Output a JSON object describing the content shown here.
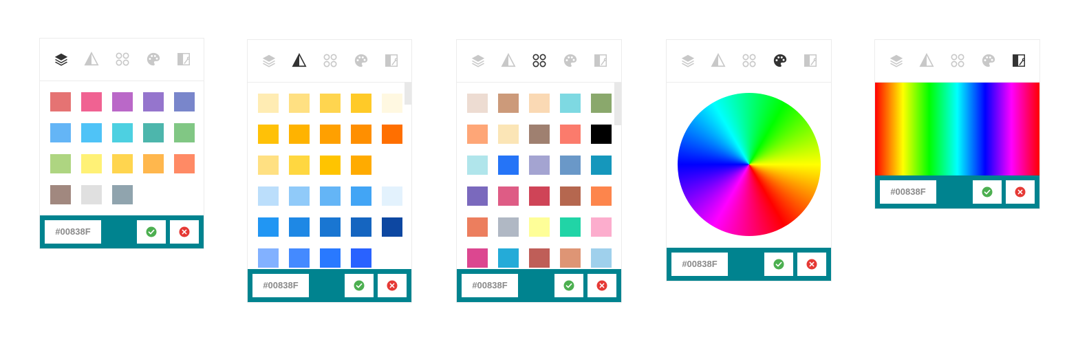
{
  "tab_icons": [
    "layers-icon",
    "shades-icon",
    "swatches-icon",
    "palette-icon",
    "spectrum-icon"
  ],
  "panels": [
    {
      "active_tab": "layers",
      "hex_value": "#00838F",
      "colors": [
        "#e57373",
        "#f06292",
        "#ba68c8",
        "#9575cd",
        "#7986cb",
        "#64b5f6",
        "#4fc3f7",
        "#4dd0e1",
        "#4db6ac",
        "#81c784",
        "#aed581",
        "#fff176",
        "#ffd54f",
        "#ffb74d",
        "#ff8a65",
        "#a1887f",
        "#e0e0e0",
        "#90a4ae"
      ]
    },
    {
      "active_tab": "shades",
      "hex_value": "#00838F",
      "colors": [
        "#ffecb3",
        "#ffe082",
        "#ffd54f",
        "#ffca28",
        "#fff8e1",
        "#ffc107",
        "#ffb300",
        "#ffa000",
        "#ff8f00",
        "#ff6f00",
        "#ffe082",
        "#ffd740",
        "#ffc400",
        "#ffab00",
        null,
        "#bbdefb",
        "#90caf9",
        "#64b5f6",
        "#42a5f5",
        "#e3f2fd",
        "#2196f3",
        "#1e88e5",
        "#1976d2",
        "#1565c0",
        "#0d47a1",
        "#82b1ff",
        "#448aff",
        "#2979ff",
        "#2962ff",
        null
      ]
    },
    {
      "active_tab": "swatches",
      "hex_value": "#00838F",
      "colors": [
        "#eddcd2",
        "#cc9a7a",
        "#fad9b4",
        "#7ed9e2",
        "#8aa86c",
        "#fea677",
        "#fbe5b6",
        "#9f8070",
        "#fb7b6c",
        "#000000",
        "#b0e5eb",
        "#2574f7",
        "#a4a4d1",
        "#6a98c8",
        "#1597bc",
        "#7a69bd",
        "#de5c85",
        "#cf4457",
        "#b5674f",
        "#fd854c",
        "#ec7e5e",
        "#b0b8c4",
        "#fefe98",
        "#21d4a6",
        "#fcadcd",
        "#dc4790",
        "#24abd8",
        "#bf5e58",
        "#de9575",
        "#9fd0ec"
      ]
    },
    {
      "active_tab": "palette",
      "hex_value": "#00838F"
    },
    {
      "active_tab": "spectrum",
      "hex_value": "#00838F"
    }
  ],
  "colors": {
    "footer_bg": "#00838f",
    "ok_green": "#4caf50",
    "cancel_red": "#e53935",
    "icon_active": "#333333",
    "icon_inactive": "#c8c8c8"
  }
}
